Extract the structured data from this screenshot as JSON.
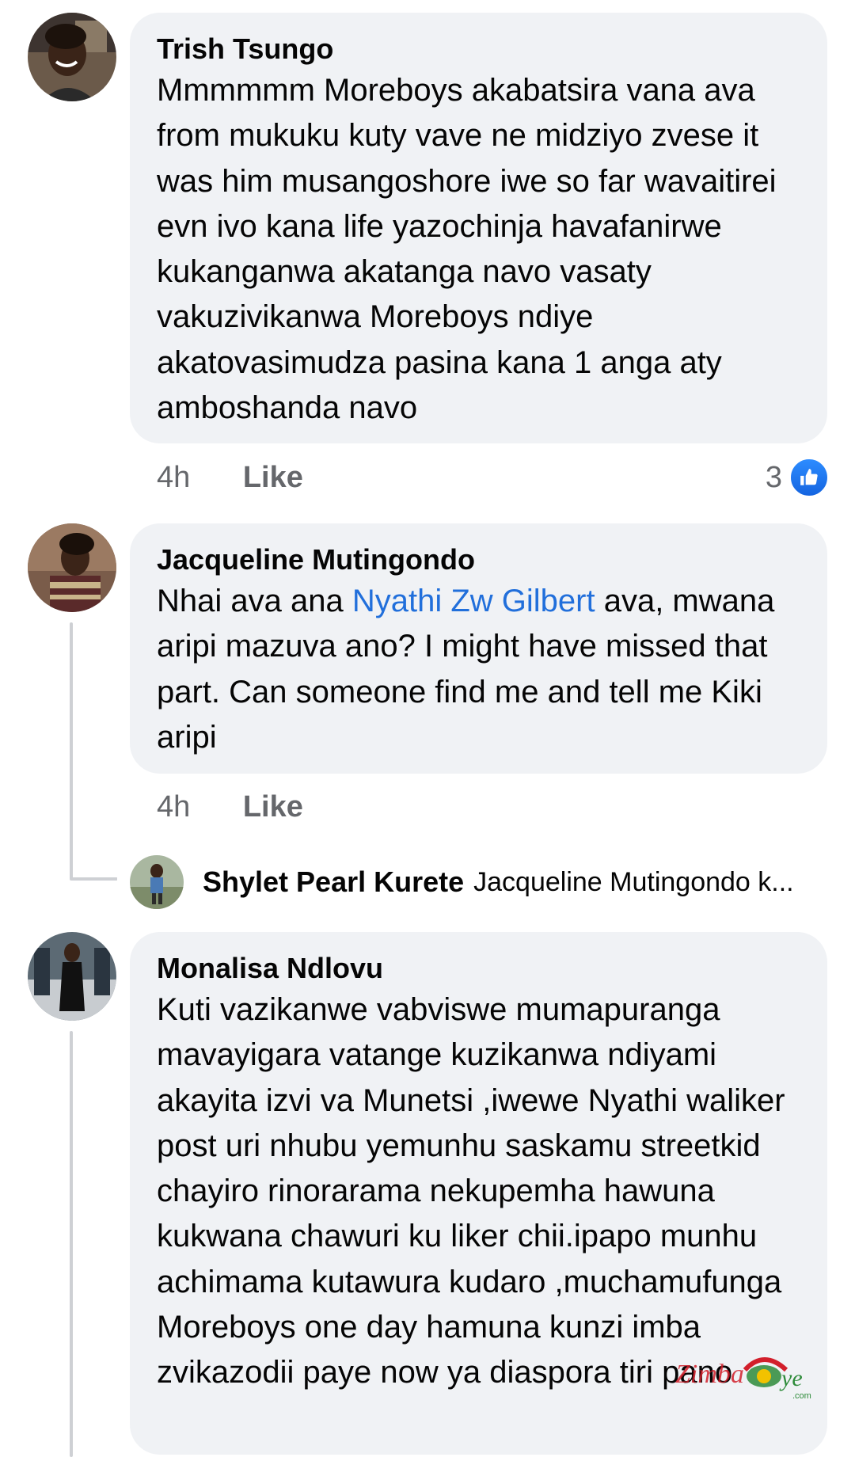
{
  "comments": [
    {
      "author": "Trish Tsungo",
      "text": "Mmmmmm Moreboys akabatsira vana ava from mukuku kuty vave ne midziyo zvese it was him musangoshore iwe so far wavaitirei evn ivo kana life yazochinja havafanirwe kukanganwa akatanga navo vasaty vakuzivikanwa Moreboys ndiye akatovasimudza pasina kana 1 anga aty amboshanda navo",
      "time": "4h",
      "like_label": "Like",
      "reaction_count": "3"
    },
    {
      "author": "Jacqueline Mutingondo",
      "text_before": "Nhai ava ana ",
      "mention": "Nyathi Zw Gilbert",
      "text_after": " ava, mwana aripi mazuva ano? I might have missed that part. Can someone find me and tell me Kiki aripi",
      "time": "4h",
      "like_label": "Like"
    },
    {
      "author": "Monalisa Ndlovu",
      "text": "Kuti vazikanwe vabviswe mumapuranga mavayigara vatange kuzikanwa ndiyami akayita izvi va Munetsi ,iwewe Nyathi waliker post uri nhubu yemunhu saskamu streetkid chayiro rinorarama nekupemha hawuna kukwana chawuri ku liker chii.ipapo munhu achimama kutawura kudaro ,muchamufunga Moreboys one day hamuna kunzi imba zvikazodii paye now ya diaspora tiri pano"
    }
  ],
  "reply_preview": {
    "author": "Shylet Pearl Kurete",
    "text": "Jacqueline Mutingondo k..."
  },
  "watermark": {
    "brand": "ZimbaEye",
    "tld": ".com"
  },
  "colors": {
    "bubble": "#f0f2f5",
    "meta_text": "#65676b",
    "mention": "#216fdb",
    "like_blue": "#1877f2"
  }
}
